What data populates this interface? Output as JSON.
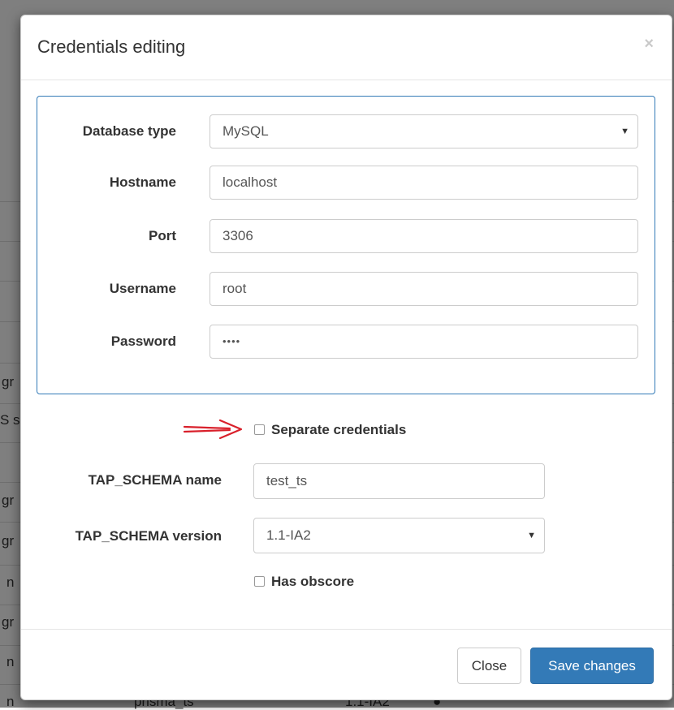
{
  "modal": {
    "title": "Credentials editing",
    "close_symbol": "×",
    "fields": {
      "database_type": {
        "label": "Database type",
        "value": "MySQL"
      },
      "hostname": {
        "label": "Hostname",
        "value": "localhost"
      },
      "port": {
        "label": "Port",
        "value": "3306"
      },
      "username": {
        "label": "Username",
        "value": "root"
      },
      "password": {
        "label": "Password",
        "value": "••••"
      }
    },
    "separate_credentials": {
      "label": "Separate credentials",
      "checked": false
    },
    "tap_schema_name": {
      "label": "TAP_SCHEMA name",
      "value": "test_ts"
    },
    "tap_schema_version": {
      "label": "TAP_SCHEMA version",
      "value": "1.1-IA2"
    },
    "has_obscore": {
      "label": "Has obscore",
      "checked": false
    },
    "footer": {
      "close_label": "Close",
      "save_label": "Save changes"
    }
  },
  "background": {
    "row_fragments": [
      "gr",
      "S s",
      "gr",
      "gr",
      "n",
      "gr",
      "n",
      "n"
    ],
    "partial_row": {
      "name": "prisma_ts",
      "version": "1.1-IA2"
    }
  },
  "icons": {
    "caret": "caret-down-icon",
    "arrow": "red-arrow-icon"
  },
  "colors": {
    "primary": "#337ab7",
    "panel_border": "#337ab7",
    "arrow": "#d9202b"
  }
}
